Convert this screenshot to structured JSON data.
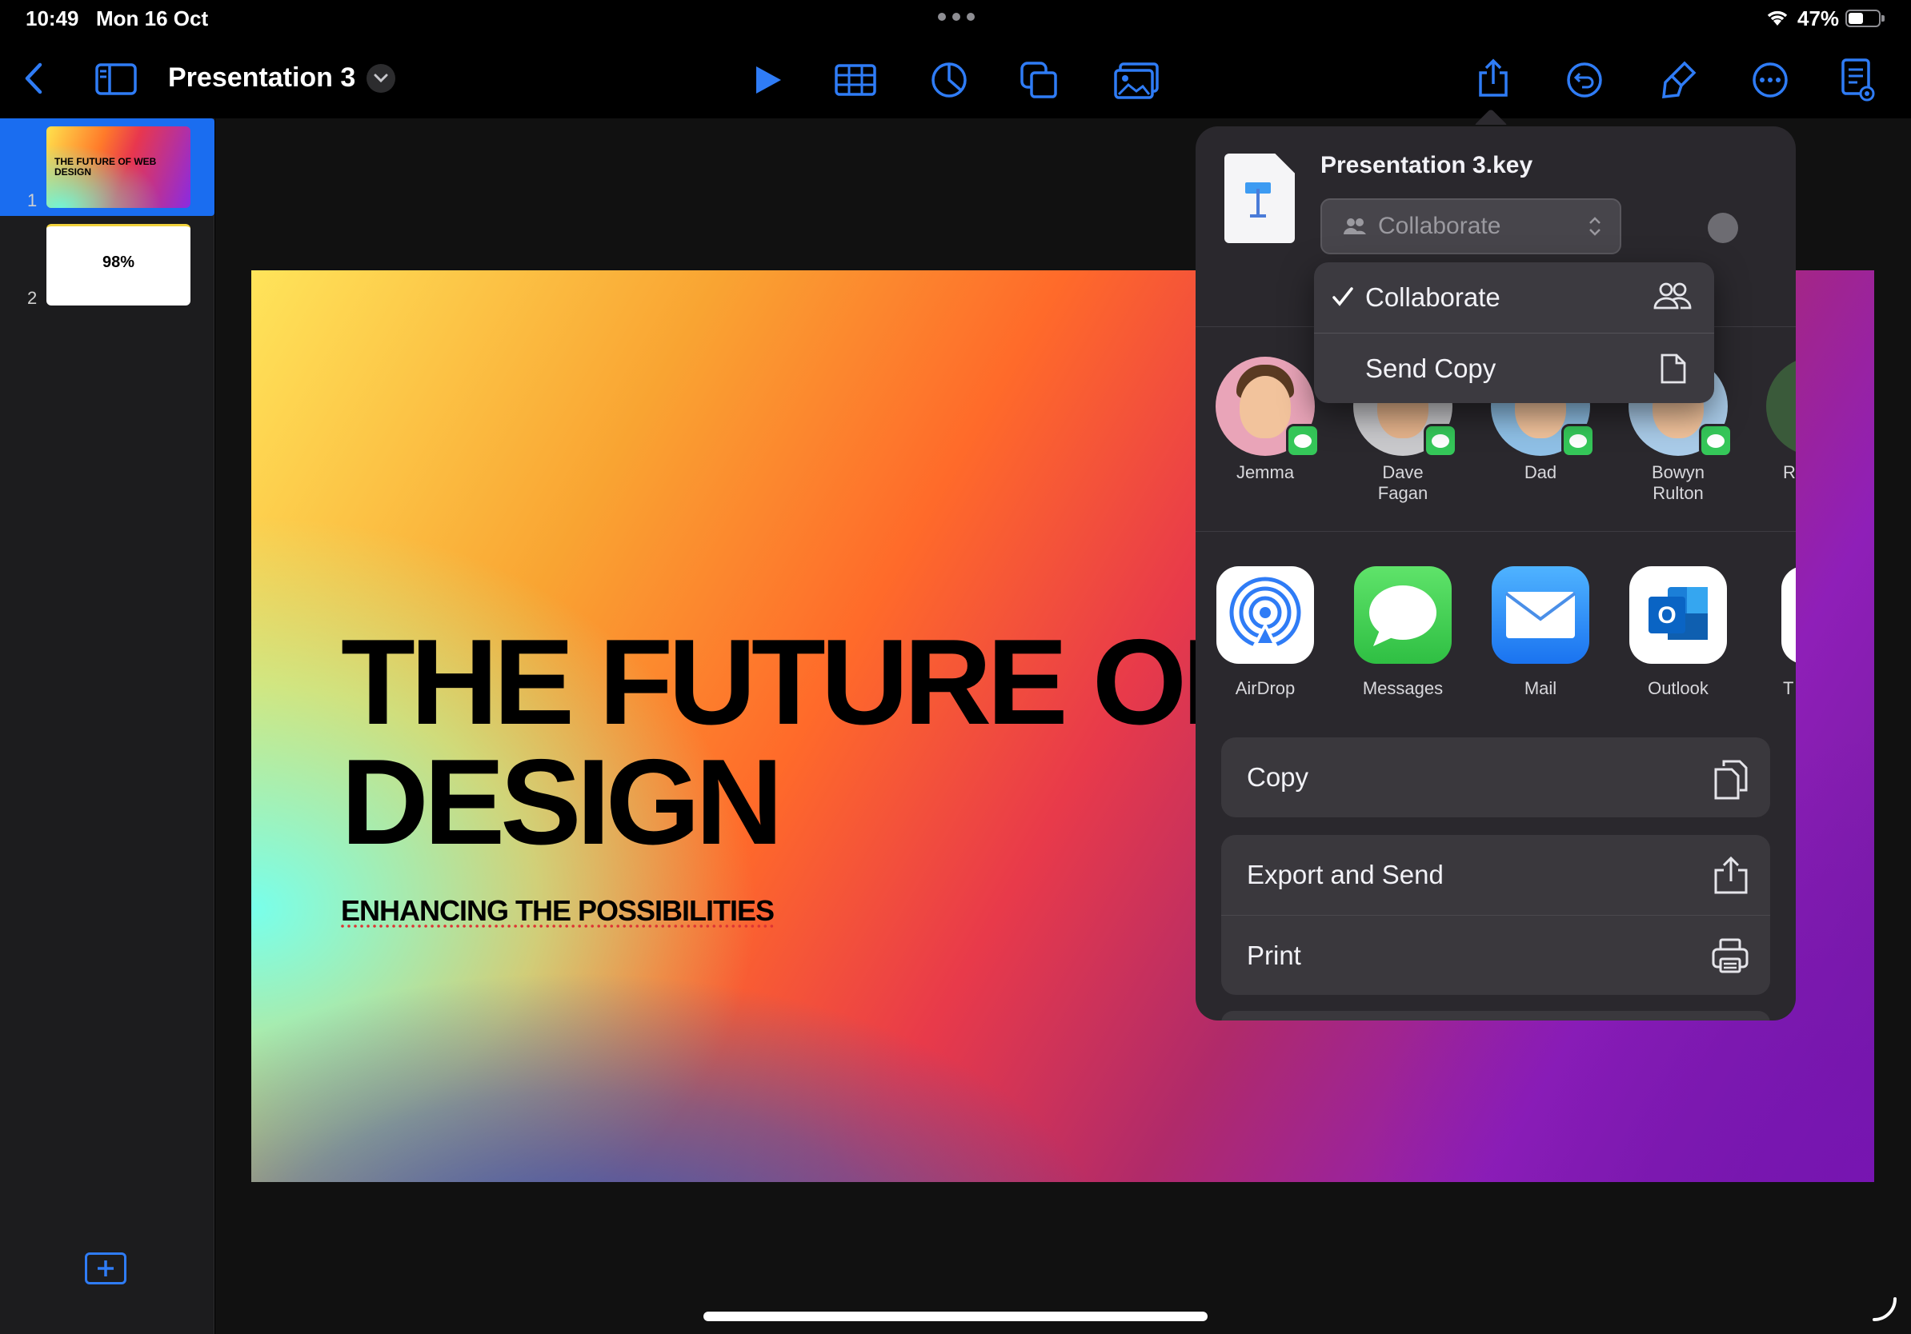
{
  "status_bar": {
    "time": "10:49",
    "date": "Mon 16 Oct",
    "battery": "47%"
  },
  "toolbar": {
    "title": "Presentation 3"
  },
  "sidebar": {
    "slides": [
      {
        "number": "1",
        "thumb_text": "THE FUTURE OF WEB DESIGN"
      },
      {
        "number": "2",
        "thumb_text": "98%"
      }
    ]
  },
  "slide": {
    "title": "THE FUTURE OF WEB\nDESIGN",
    "subtitle": "ENHANCING THE POSSIBILITIES"
  },
  "share_sheet": {
    "file_name": "Presentation 3.key",
    "mode_select": "Collaborate",
    "mode_menu": {
      "collaborate": "Collaborate",
      "send_copy": "Send Copy"
    },
    "people": [
      {
        "name": "Jemma"
      },
      {
        "name": "Dave\nFagan"
      },
      {
        "name": "Dad"
      },
      {
        "name": "Bowyn\nRulton"
      },
      {
        "name": "R"
      }
    ],
    "apps": [
      {
        "name": "AirDrop"
      },
      {
        "name": "Messages"
      },
      {
        "name": "Mail"
      },
      {
        "name": "Outlook"
      },
      {
        "name": "T"
      }
    ],
    "actions": {
      "copy": "Copy",
      "export_send": "Export and Send",
      "print": "Print"
    }
  },
  "colors": {
    "accent": "#2f7cf6",
    "selected_slide": "#1a6df0",
    "popover_bg": "#2a282d"
  }
}
